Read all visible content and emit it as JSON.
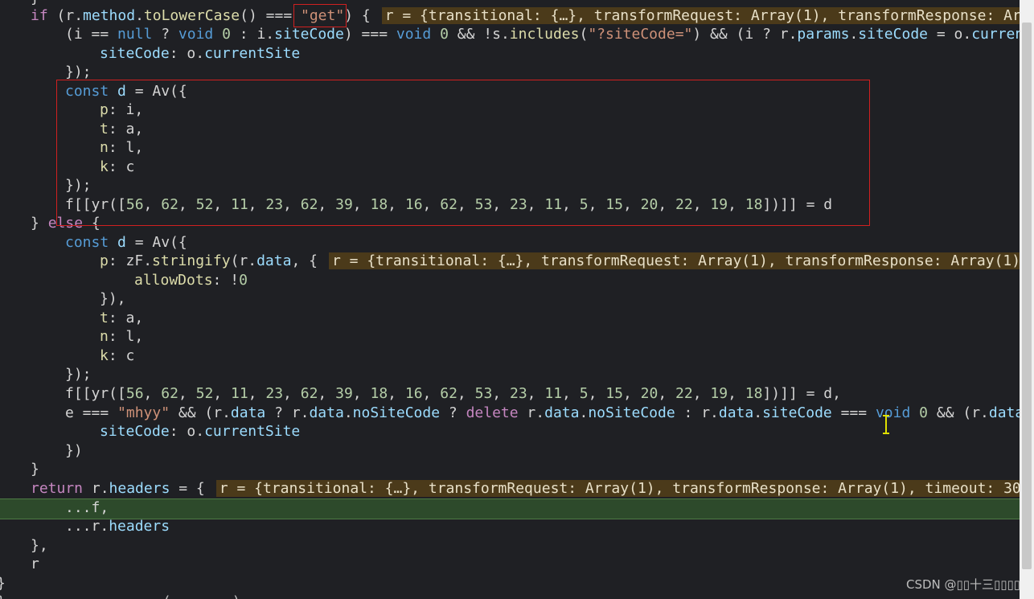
{
  "code": {
    "l0": "}",
    "l1": {
      "kw": "if",
      "a": " (r.",
      "method": "method",
      "b": ".",
      "toLower": "toLowerCase",
      "c": "() === ",
      "get": "\"get\"",
      "d": ") {",
      "hint": "r = {transitional: {…}, transformRequest: Array(1), transformResponse: Ar"
    },
    "l2": {
      "a": "(i == ",
      "null": "null",
      "b": " ? ",
      "void": "void",
      "zero": " 0",
      "c": " : i.",
      "siteCode": "siteCode",
      "d": ") === ",
      "void2": "void",
      "zero2": " 0",
      "e": " && !s.",
      "includes": "includes",
      "f": "(",
      "str": "\"?siteCode=\"",
      "g": ") && (i ? r.",
      "params": "params",
      "h": ".",
      "siteCode2": "siteCode",
      "i": " = o.",
      "current": "curren"
    },
    "l3": {
      "prop": "siteCode",
      "a": ": o.",
      "current": "currentSite"
    },
    "l4": "});",
    "l5": {
      "kw": "const",
      "a": " ",
      "d": "d",
      "b": " = Av({"
    },
    "l6": {
      "p": "p",
      "v": ": i,"
    },
    "l7": {
      "p": "t",
      "v": ": a,"
    },
    "l8": {
      "p": "n",
      "v": ": l,"
    },
    "l9": {
      "p": "k",
      "v": ": c"
    },
    "l10": "});",
    "l11": {
      "a": "f[[yr([",
      "nums": [
        "56",
        "62",
        "52",
        "11",
        "23",
        "62",
        "39",
        "18",
        "16",
        "62",
        "53",
        "23",
        "11",
        "5",
        "15",
        "20",
        "22",
        "19",
        "18"
      ],
      "b": "])]] = d"
    },
    "l12": {
      "a": "} ",
      "kw": "else",
      "b": " {"
    },
    "l13": {
      "kw": "const",
      "a": " ",
      "d": "d",
      "b": " = Av({"
    },
    "l14": {
      "p": "p",
      "a": ": zF.",
      "fn": "stringify",
      "b": "(r.",
      "data": "data",
      "c": ", {",
      "hint": "r = {transitional: {…}, transformRequest: Array(1), transformResponse: Array(1)"
    },
    "l15": {
      "p": "allowDots",
      "a": ": !",
      "num": "0"
    },
    "l16": "}),",
    "l17": {
      "p": "t",
      "v": ": a,"
    },
    "l18": {
      "p": "n",
      "v": ": l,"
    },
    "l19": {
      "p": "k",
      "v": ": c"
    },
    "l20": "});",
    "l21": {
      "a": "f[[yr([",
      "nums": [
        "56",
        "62",
        "52",
        "11",
        "23",
        "62",
        "39",
        "18",
        "16",
        "62",
        "53",
        "23",
        "11",
        "5",
        "15",
        "20",
        "22",
        "19",
        "18"
      ],
      "b": "])]] = d,"
    },
    "l22": {
      "a": "e === ",
      "str": "\"mhyy\"",
      "b": " && (r.",
      "data": "data",
      "c": " ? r.",
      "data2": "data",
      "d": ".",
      "noSite": "noSiteCode",
      "e": " ? ",
      "del": "delete",
      "f": " r.",
      "data3": "data",
      "g": ".",
      "noSite2": "noSiteCode",
      "h": " : r.",
      "data4": "data",
      "i": ".",
      "siteCode": "siteCode",
      "j": " === ",
      "void": "void",
      "zero": " 0",
      "k": " && (r.",
      "data5": "data"
    },
    "l23": {
      "prop": "siteCode",
      "a": ": o.",
      "current": "currentSite"
    },
    "l24": "})",
    "l25": "}",
    "l26": {
      "kw": "return",
      "a": " r.",
      "headers": "headers",
      "b": " = {",
      "hint": "r = {transitional: {…}, transformRequest: Array(1), transformResponse: Array(1), timeout: 30"
    },
    "l27": "...f,",
    "l28": {
      "a": "...r.",
      "headers": "headers"
    },
    "l29": "},",
    "l30": "r",
    "l31": "}",
    "l32": "}, ... ... ... ... (... ...)"
  },
  "watermark": "CSDN @▯▯十三▯▯▯▯"
}
